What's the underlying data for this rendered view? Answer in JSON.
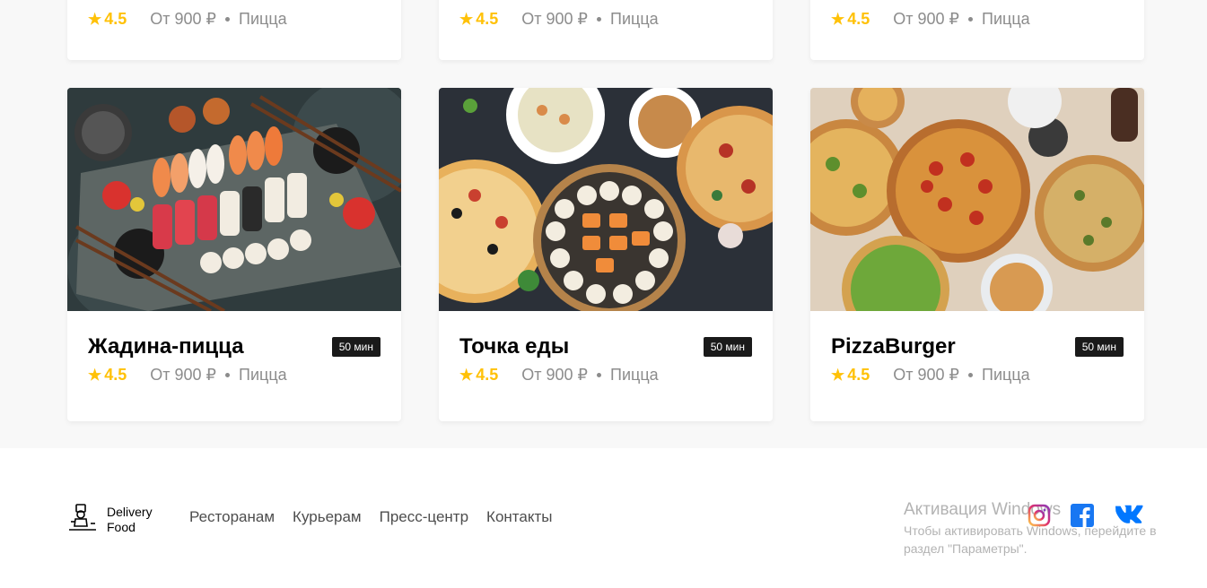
{
  "top_cards": [
    {
      "rating": "4.5",
      "price": "От 900 ₽",
      "category": "Пицца"
    },
    {
      "rating": "4.5",
      "price": "От 900 ₽",
      "category": "Пицца"
    },
    {
      "rating": "4.5",
      "price": "От 900 ₽",
      "category": "Пицца"
    }
  ],
  "cards": [
    {
      "name": "Жадина-пицца",
      "time": "50 мин",
      "rating": "4.5",
      "price": "От 900 ₽",
      "category": "Пицца"
    },
    {
      "name": "Точка еды",
      "time": "50 мин",
      "rating": "4.5",
      "price": "От 900 ₽",
      "category": "Пицца"
    },
    {
      "name": "PizzaBurger",
      "time": "50 мин",
      "rating": "4.5",
      "price": "От 900 ₽",
      "category": "Пицца"
    }
  ],
  "footer": {
    "logo": {
      "line1": "Delivery",
      "line2": "Food"
    },
    "nav": [
      "Ресторанам",
      "Курьерам",
      "Пресс-центр",
      "Контакты"
    ],
    "social": [
      "instagram-icon",
      "facebook-icon",
      "vk-icon"
    ]
  },
  "windows_activation": {
    "title": "Активация Windows",
    "text": "Чтобы активировать Windows, перейдите в раздел \"Параметры\"."
  },
  "colors": {
    "rating": "#ffc107",
    "badge": "#1a1a1a",
    "meta": "#8c8c8c"
  }
}
